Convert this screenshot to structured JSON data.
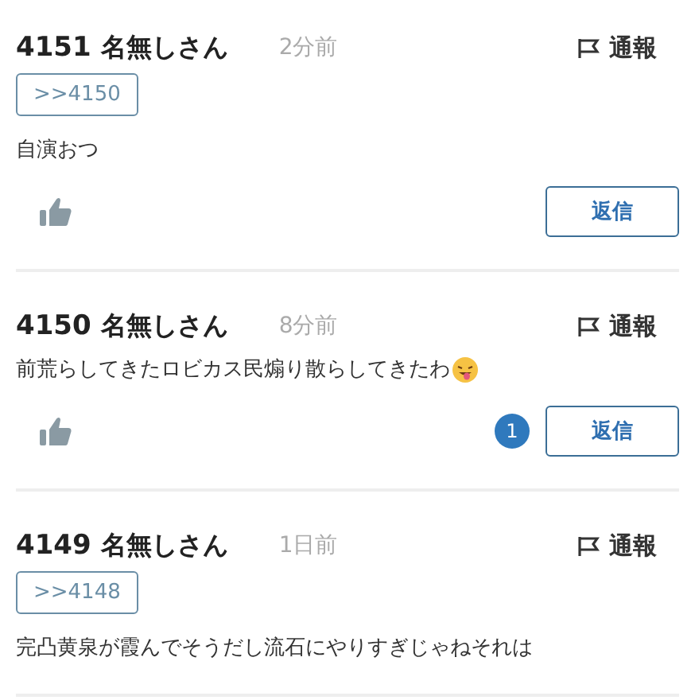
{
  "posts": [
    {
      "number": "4151",
      "name": "名無しさん",
      "time": "2分前",
      "report": "通報",
      "anchor": ">>4150",
      "body": "自演おつ",
      "emoji": false,
      "reply": "返信"
    },
    {
      "number": "4150",
      "name": "名無しさん",
      "time": "8分前",
      "report": "通報",
      "body": "前荒らしてきたロビカス民煽り散らしてきたわ",
      "emoji": true,
      "reply_count": "1",
      "reply": "返信"
    },
    {
      "number": "4149",
      "name": "名無しさん",
      "time": "1日前",
      "report": "通報",
      "anchor": ">>4148",
      "body": "完凸黄泉が霞んでそうだし流石にやりすぎじゃねそれは",
      "emoji": false
    }
  ]
}
